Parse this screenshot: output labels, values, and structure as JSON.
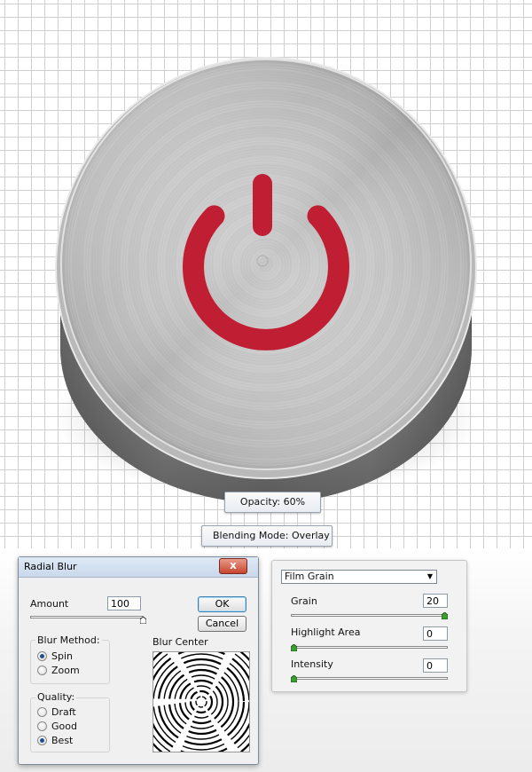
{
  "artwork": {
    "opacity_label": "Opacity: 60%",
    "blend_label": "Blending Mode: Overlay",
    "icon": "power-icon",
    "icon_color": "#c01e33"
  },
  "radial_blur": {
    "title": "Radial Blur",
    "close_label": "x",
    "amount_label": "Amount",
    "amount_value": "100",
    "ok_label": "OK",
    "cancel_label": "Cancel",
    "blur_method_label": "Blur Method:",
    "methods": [
      {
        "label": "Spin",
        "checked": true
      },
      {
        "label": "Zoom",
        "checked": false
      }
    ],
    "quality_label": "Quality:",
    "qualities": [
      {
        "label": "Draft",
        "checked": false
      },
      {
        "label": "Good",
        "checked": false
      },
      {
        "label": "Best",
        "checked": true
      }
    ],
    "blur_center_label": "Blur Center"
  },
  "film_grain": {
    "filter_name": "Film Grain",
    "controls": [
      {
        "label": "Grain",
        "value": "20",
        "level": 1.0
      },
      {
        "label": "Highlight Area",
        "value": "0",
        "level": 0.0
      },
      {
        "label": "Intensity",
        "value": "0",
        "level": 0.0
      }
    ],
    "thumb_color": "#3a9e2f"
  }
}
